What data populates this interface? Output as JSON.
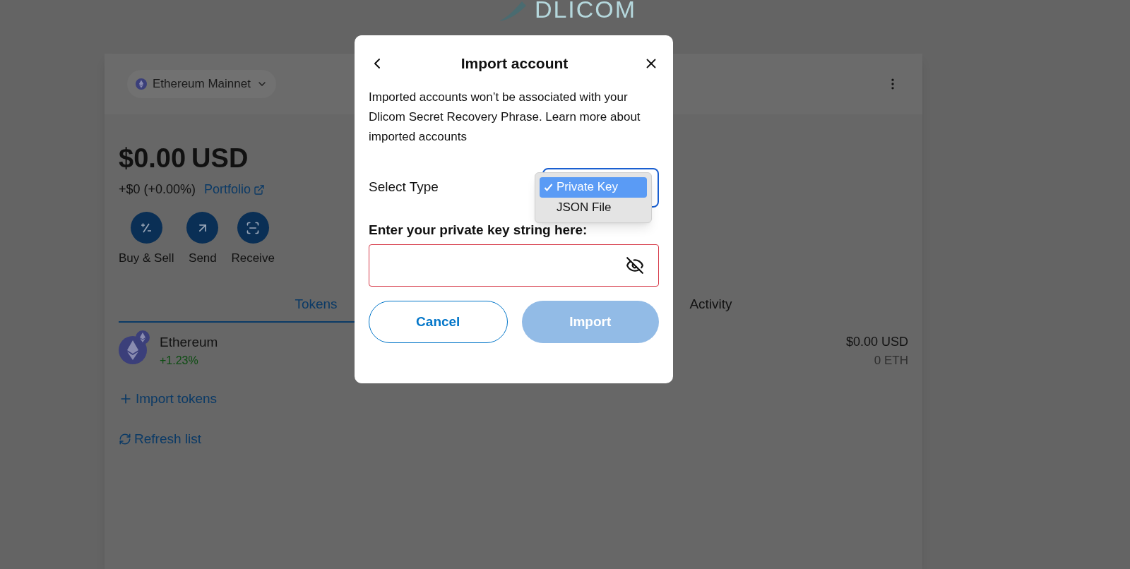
{
  "brand": "DLICOM",
  "network": {
    "label": "Ethereum Mainnet"
  },
  "balance": {
    "amount": "$0.00",
    "currency": "USD",
    "change": "+$0 (+0.00%)",
    "portfolio_link": "Portfolio"
  },
  "actions": [
    {
      "label": "Buy & Sell",
      "kind": "buy-sell"
    },
    {
      "label": "Send",
      "kind": "send"
    },
    {
      "label": "Receive",
      "kind": "receive"
    }
  ],
  "tabs": [
    {
      "label": "Tokens",
      "selected": true
    },
    {
      "label": "Activity",
      "selected": false
    }
  ],
  "tokens": [
    {
      "name": "Ethereum",
      "change": "+1.23%",
      "fiat": "$0.00 USD",
      "amount": "0 ETH"
    }
  ],
  "links": [
    {
      "label": "Import tokens",
      "kind": "add"
    },
    {
      "label": "Refresh list",
      "kind": "refresh"
    }
  ],
  "dialog": {
    "title": "Import account",
    "description": "Imported accounts won’t be associated with your Dlicom Secret Recovery Phrase. Learn more about imported accounts",
    "select_label": "Select Type",
    "options": [
      {
        "label": "Private Key",
        "selected": true
      },
      {
        "label": "JSON File",
        "selected": false
      }
    ],
    "key_label": "Enter your private key string here:",
    "key_invalid": true,
    "buttons": [
      {
        "label": "Cancel",
        "kind": "secondary",
        "disabled": false
      },
      {
        "label": "Import",
        "kind": "primary",
        "disabled": true
      }
    ]
  }
}
